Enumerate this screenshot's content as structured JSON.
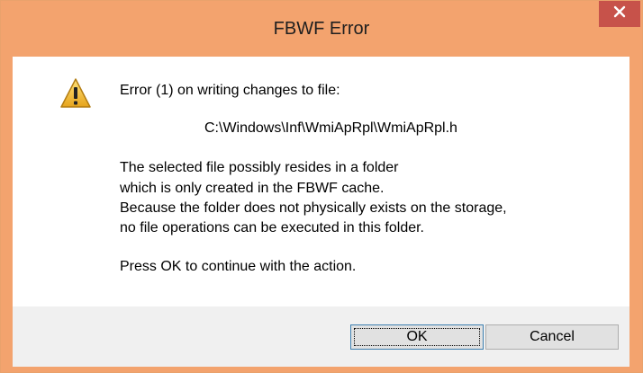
{
  "window": {
    "title": "FBWF Error",
    "close_glyph": "✕"
  },
  "message": {
    "heading": "Error (1) on writing changes to file:",
    "path": "C:\\Windows\\Inf\\WmiApRpl\\WmiApRpl.h",
    "body_lines": [
      "The selected file possibly resides in a folder",
      "which is only created in the FBWF cache.",
      "Because the folder does not physically exists on the storage,",
      "no file operations can be executed in this folder."
    ],
    "prompt": "Press OK to continue with the action."
  },
  "buttons": {
    "ok_label": "OK",
    "cancel_label": "Cancel"
  },
  "icons": {
    "warning": "warning-icon",
    "close": "close-icon"
  },
  "colors": {
    "titlebar": "#f3a36e",
    "close_button": "#c7524a",
    "warning_fill": "#f5c43b"
  }
}
